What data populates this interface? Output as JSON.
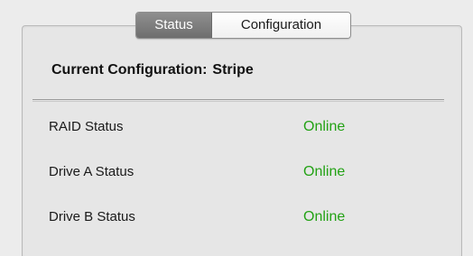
{
  "tabs": [
    {
      "label": "Status",
      "selected": true
    },
    {
      "label": "Configuration",
      "selected": false
    }
  ],
  "current_configuration": {
    "label": "Current Configuration:",
    "value": "Stripe"
  },
  "status_rows": [
    {
      "label": "RAID Status",
      "value": "Online"
    },
    {
      "label": "Drive A Status",
      "value": "Online"
    },
    {
      "label": "Drive B Status",
      "value": "Online"
    }
  ],
  "colors": {
    "status_online": "#23a215",
    "tab_selected_bg": "#7c7c7c"
  }
}
